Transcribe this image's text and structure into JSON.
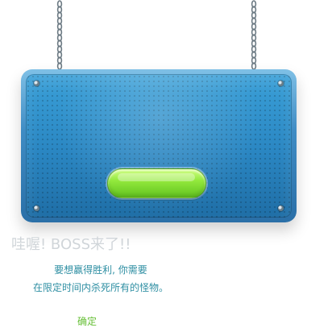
{
  "dialog": {
    "title": "哇喔! BOSS来了!!",
    "message_lines": [
      "要想赢得胜利, 你需要",
      "在限定时间内杀死所有的怪物。"
    ],
    "confirm_label": "确定",
    "center_button_label": ""
  },
  "colors": {
    "panel_blue": "#2a86c2",
    "panel_border": "#7fc0e6",
    "button_green": "#93e93d",
    "headline_gray": "#d0d5d9",
    "message_teal": "#2f8fa3",
    "confirm_green": "#66bf36"
  },
  "icons": {
    "left_chain": "chain-icon",
    "right_chain": "chain-icon",
    "corner_bolts": "bolt-icon"
  }
}
